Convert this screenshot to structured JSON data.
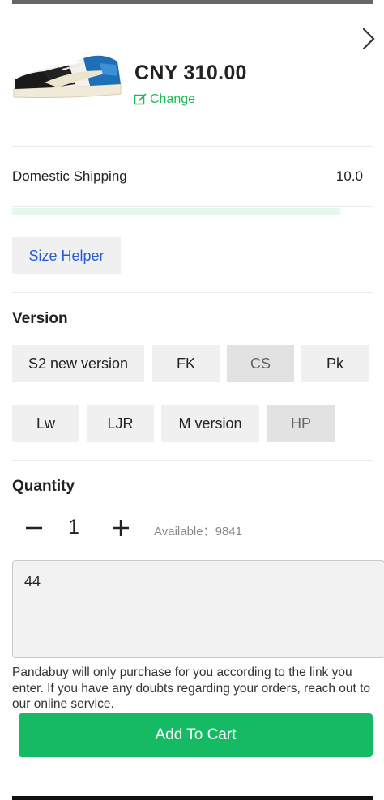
{
  "product": {
    "price": "CNY 310.00",
    "change_label": "Change",
    "image_icon": "sneaker-image"
  },
  "shipping": {
    "label": "Domestic Shipping",
    "value": "10.0",
    "progress_fraction": 0.91
  },
  "size_helper_label": "Size Helper",
  "version": {
    "title": "Version",
    "options": [
      "S2 new version",
      "FK",
      "CS",
      "Pk",
      "Lw",
      "LJR",
      "M version",
      "HP"
    ],
    "selected": [
      "CS",
      "HP"
    ]
  },
  "quantity": {
    "title": "Quantity",
    "value": "1",
    "available": "Available：9841"
  },
  "note": {
    "value": "44"
  },
  "disclaimer": {
    "line1": "Pandabuy will only purchase for you according to the link you",
    "line2": "enter. If you have any doubts regarding your orders, reach out to",
    "line3": "our online service."
  },
  "add_to_cart_label": "Add To Cart",
  "colors": {
    "accent_green": "#17ba64",
    "link_blue": "#2a5bd7"
  }
}
